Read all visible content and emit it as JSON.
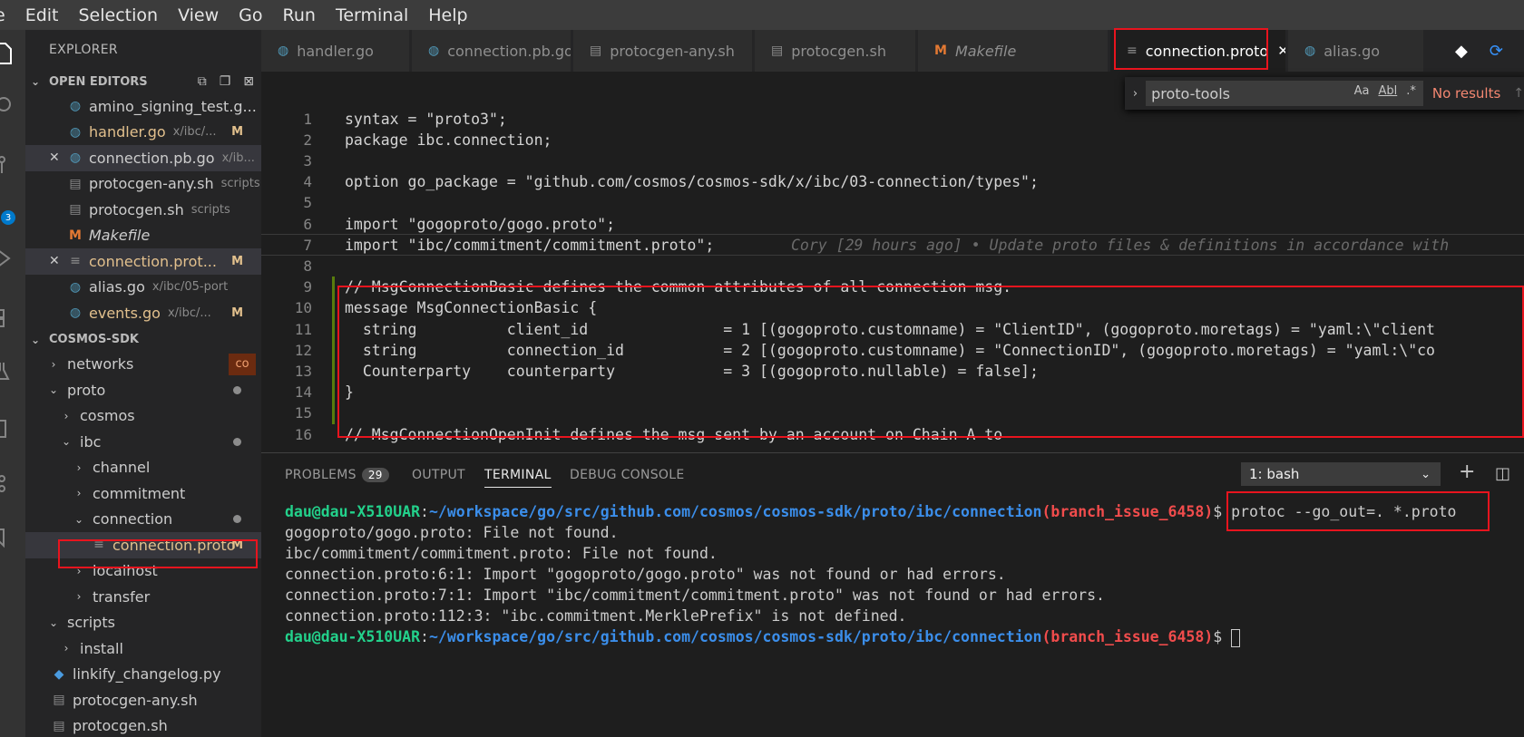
{
  "menu": [
    "e",
    "Edit",
    "Selection",
    "View",
    "Go",
    "Run",
    "Terminal",
    "Help"
  ],
  "activity_badge": "3",
  "explorer": {
    "title": "EXPLORER",
    "open_editors_label": "OPEN EDITORS",
    "open_editors": [
      {
        "name": "amino_signing_test.g...",
        "desc": "",
        "icon": "go",
        "close": false,
        "m": ""
      },
      {
        "name": "handler.go",
        "desc": "x/ibc/...",
        "icon": "go",
        "close": false,
        "m": "M",
        "modified": true
      },
      {
        "name": "connection.pb.go",
        "desc": "x/ib...",
        "icon": "go",
        "close": true,
        "m": ""
      },
      {
        "name": "protocgen-any.sh",
        "desc": "scripts",
        "icon": "sh",
        "close": false,
        "m": ""
      },
      {
        "name": "protocgen.sh",
        "desc": "scripts",
        "icon": "sh",
        "close": false,
        "m": ""
      },
      {
        "name": "Makefile",
        "desc": "",
        "icon": "make",
        "close": false,
        "m": "",
        "italic": true
      },
      {
        "name": "connection.prot...",
        "desc": "",
        "icon": "proto",
        "close": true,
        "m": "M",
        "modified": true
      },
      {
        "name": "alias.go",
        "desc": "x/ibc/05-port",
        "icon": "go",
        "close": false,
        "m": ""
      },
      {
        "name": "events.go",
        "desc": "x/ibc/...",
        "icon": "go",
        "close": false,
        "m": "M",
        "modified": true
      }
    ],
    "workspace_label": "COSMOS-SDK",
    "tree": {
      "networks": "networks",
      "networks_badge": "co",
      "proto": "proto",
      "cosmos": "cosmos",
      "ibc": "ibc",
      "channel": "channel",
      "commitment": "commitment",
      "connection": "connection",
      "connection_proto": "connection.proto",
      "connection_proto_m": "M",
      "localhost": "localhost",
      "transfer": "transfer",
      "scripts": "scripts",
      "install": "install",
      "linkify": "linkify_changelog.py",
      "protocgen_any": "protocgen-any.sh",
      "protocgen": "protocgen.sh"
    }
  },
  "tabs": [
    {
      "label": "handler.go",
      "icon": "go"
    },
    {
      "label": "connection.pb.go",
      "icon": "go"
    },
    {
      "label": "protocgen-any.sh",
      "icon": "sh"
    },
    {
      "label": "protocgen.sh",
      "icon": "sh"
    },
    {
      "label": "Makefile",
      "icon": "make"
    },
    {
      "label": "connection.proto",
      "icon": "proto",
      "active": true
    },
    {
      "label": "alias.go",
      "icon": "go"
    }
  ],
  "find": {
    "value": "proto-tools",
    "opt_case": "Aa",
    "opt_word": "Abl",
    "opt_regex": ".*",
    "result": "No results"
  },
  "editor": {
    "lines": [
      {
        "n": "1",
        "text": "syntax = \"proto3\";"
      },
      {
        "n": "2",
        "text": "package ibc.connection;"
      },
      {
        "n": "3",
        "text": ""
      },
      {
        "n": "4",
        "text": "option go_package = \"github.com/cosmos/cosmos-sdk/x/ibc/03-connection/types\";"
      },
      {
        "n": "5",
        "text": ""
      },
      {
        "n": "6",
        "text": "import \"gogoproto/gogo.proto\";"
      },
      {
        "n": "7",
        "text": "import \"ibc/commitment/commitment.proto\";"
      },
      {
        "n": "8",
        "text": ""
      },
      {
        "n": "9",
        "text": "// MsgConnectionBasic defines the common attributes of all connection msg."
      },
      {
        "n": "10",
        "text": "message MsgConnectionBasic {"
      },
      {
        "n": "11",
        "text": "  string          client_id               = 1 [(gogoproto.customname) = \"ClientID\", (gogoproto.moretags) = \"yaml:\\\"client"
      },
      {
        "n": "12",
        "text": "  string          connection_id           = 2 [(gogoproto.customname) = \"ConnectionID\", (gogoproto.moretags) = \"yaml:\\\"co"
      },
      {
        "n": "13",
        "text": "  Counterparty    counterparty            = 3 [(gogoproto.nullable) = false];"
      },
      {
        "n": "14",
        "text": "}"
      },
      {
        "n": "15",
        "text": ""
      },
      {
        "n": "16",
        "text": "// MsgConnectionOpenInit defines the msg sent by an account on Chain A to"
      }
    ],
    "blame": "Cory [29 hours ago] • Update proto files & definitions in accordance with"
  },
  "panel": {
    "tabs": [
      "PROBLEMS",
      "OUTPUT",
      "TERMINAL",
      "DEBUG CONSOLE"
    ],
    "problems_count": "29",
    "terminal_select": "1: bash",
    "prompt_user": "dau@dau-X510UAR",
    "prompt_sep": ":",
    "prompt_path": "~/workspace/go/src/github.com/cosmos/cosmos-sdk/proto/ibc/connection",
    "prompt_branch": "(branch_issue_6458)",
    "prompt_dollar": "$ ",
    "command": "protoc --go_out=. *.proto",
    "output": [
      "gogoproto/gogo.proto: File not found.",
      "ibc/commitment/commitment.proto: File not found.",
      "connection.proto:6:1: Import \"gogoproto/gogo.proto\" was not found or had errors.",
      "connection.proto:7:1: Import \"ibc/commitment/commitment.proto\" was not found or had errors.",
      "connection.proto:112:3: \"ibc.commitment.MerklePrefix\" is not defined."
    ]
  },
  "colors": {
    "annotation": "#e8141e",
    "accent": "#007acc",
    "modified": "#e2c08d"
  }
}
